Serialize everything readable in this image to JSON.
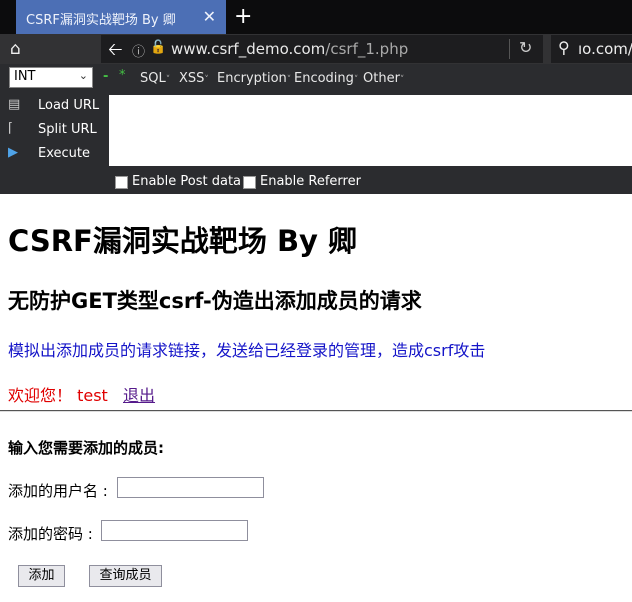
{
  "browser": {
    "tab_title": "CSRF漏洞实战靶场 By 卿",
    "url_domain": "www.csrf_demo.com",
    "url_path": "/csrf_1.php",
    "search_text": "ıo.com/i"
  },
  "hackbar": {
    "select_value": "INT",
    "menus": [
      "SQL",
      "XSS",
      "Encryption",
      "Encoding",
      "Other"
    ],
    "load_url": "Load URL",
    "split_url": "Split URL",
    "execute": "Execute",
    "enable_post": "Enable Post data",
    "enable_referrer": "Enable Referrer"
  },
  "page": {
    "title": "CSRF漏洞实战靶场 By 卿",
    "subtitle": "无防护GET类型csrf-伪造出添加成员的请求",
    "description": "模拟出添加成员的请求链接，发送给已经登录的管理，造成csrf攻击",
    "welcome": "欢迎您！  test",
    "logout": "退出",
    "form_heading": "输入您需要添加的成员:",
    "username_label": "添加的用户名 :",
    "password_label": "添加的密码 :",
    "add_button": "添加",
    "query_button": "查询成员"
  }
}
